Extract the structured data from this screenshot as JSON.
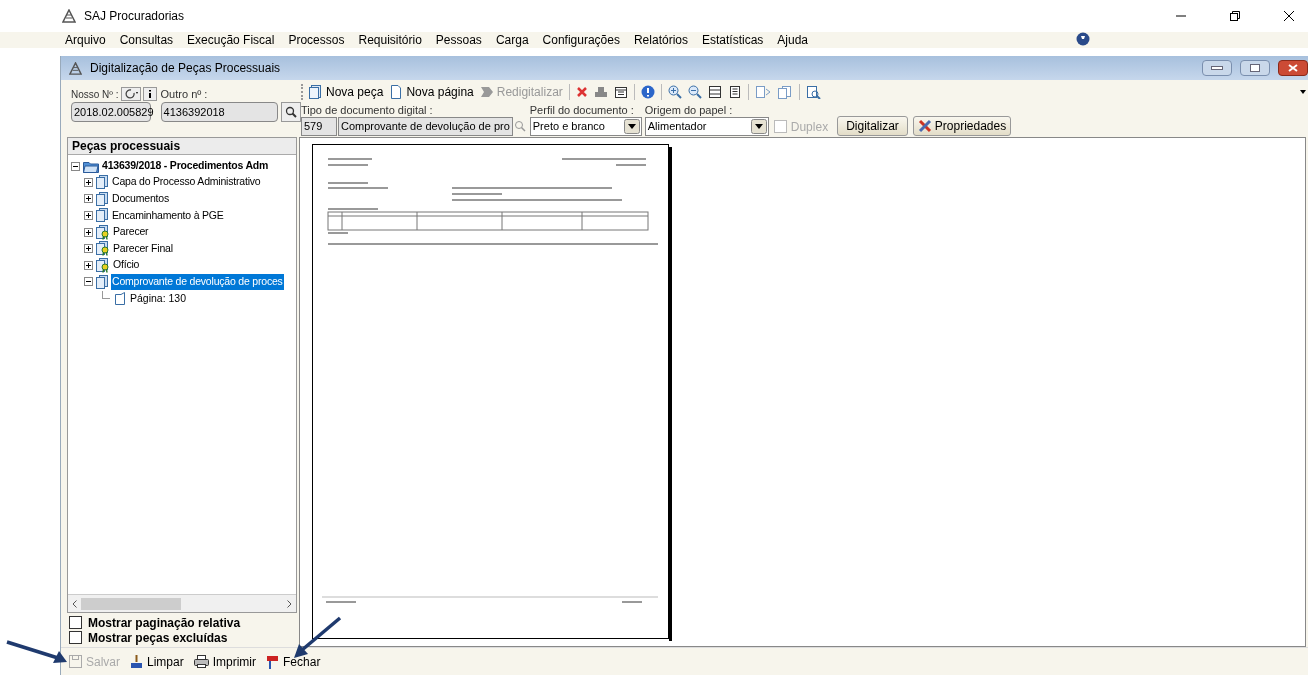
{
  "window": {
    "title": "SAJ Procuradorias"
  },
  "menu": [
    "Arquivo",
    "Consultas",
    "Execução Fiscal",
    "Processos",
    "Requisitório",
    "Pessoas",
    "Carga",
    "Configurações",
    "Relatórios",
    "Estatísticas",
    "Ajuda"
  ],
  "child_window": {
    "title": "Digitalização de Peças Processuais"
  },
  "search": {
    "nosso_label": "Nosso Nº :",
    "nosso_value": "2018.02.005829",
    "outro_label": "Outro nº :",
    "outro_value": "4136392018"
  },
  "toolbar": [
    {
      "kind": "new-piece",
      "label": "Nova peça",
      "disabled": false
    },
    {
      "kind": "new-page",
      "label": "Nova página",
      "disabled": false
    },
    {
      "kind": "rescan",
      "label": "Redigitalizar",
      "disabled": true
    }
  ],
  "document_fields": {
    "type_label": "Tipo de documento digital :",
    "type_code": "579",
    "type_value": "Comprovante de devolução de pro",
    "profile_label": "Perfil do documento :",
    "profile_value": "Preto e branco",
    "origin_label": "Origem do papel :",
    "origin_value": "Alimentador",
    "duplex": {
      "label": "Duplex",
      "checked": false,
      "disabled": true
    },
    "scan_button": "Digitalizar",
    "properties_button": "Propriedades"
  },
  "tree": {
    "title": "Peças processuais",
    "root": {
      "label": "413639/2018 - Procedimentos Adm",
      "expanded": true,
      "children": [
        {
          "label": "Capa do Processo Administrativo",
          "kind": "document",
          "expanded": false,
          "selected": false
        },
        {
          "label": "Documentos",
          "kind": "document",
          "expanded": false,
          "selected": false
        },
        {
          "label": "Encaminhamento à PGE",
          "kind": "document",
          "expanded": false,
          "selected": false
        },
        {
          "label": "Parecer",
          "kind": "signed",
          "expanded": false,
          "selected": false
        },
        {
          "label": "Parecer Final",
          "kind": "signed",
          "expanded": false,
          "selected": false
        },
        {
          "label": "Ofício",
          "kind": "signed",
          "expanded": false,
          "selected": false
        },
        {
          "label": "Comprovante de devolução de proces",
          "kind": "document",
          "expanded": true,
          "selected": true,
          "children": [
            {
              "label": "Página: 130",
              "kind": "page"
            }
          ]
        }
      ]
    }
  },
  "options": [
    {
      "label": "Mostrar paginação relativa",
      "checked": false
    },
    {
      "label": "Mostrar peças excluídas",
      "checked": false
    }
  ],
  "actions": [
    {
      "kind": "save",
      "label": "Salvar",
      "disabled": true
    },
    {
      "kind": "clear",
      "label": "Limpar",
      "disabled": false
    },
    {
      "kind": "print",
      "label": "Imprimir",
      "disabled": false
    },
    {
      "kind": "close",
      "label": "Fechar",
      "disabled": false
    }
  ]
}
